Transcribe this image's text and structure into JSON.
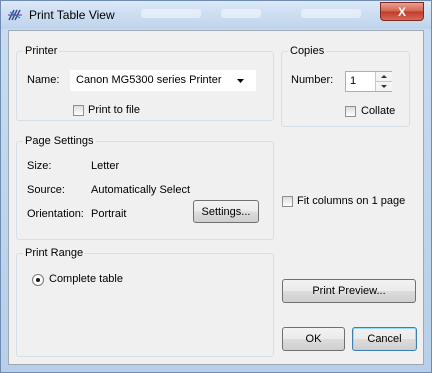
{
  "window": {
    "title": "Print Table View",
    "close_label": "X"
  },
  "printer": {
    "group_label": "Printer",
    "name_label": "Name:",
    "name_value": "Canon MG5300 series Printer",
    "print_to_file_label": "Print to file",
    "print_to_file_checked": false
  },
  "copies": {
    "group_label": "Copies",
    "number_label": "Number:",
    "number_value": "1",
    "collate_label": "Collate",
    "collate_checked": false
  },
  "page_settings": {
    "group_label": "Page Settings",
    "size_label": "Size:",
    "size_value": "Letter",
    "source_label": "Source:",
    "source_value": "Automatically Select",
    "orientation_label": "Orientation:",
    "orientation_value": "Portrait",
    "settings_button": "Settings..."
  },
  "fit_columns_label": "Fit columns on 1 page",
  "print_range": {
    "group_label": "Print Range",
    "complete_table_label": "Complete table"
  },
  "buttons": {
    "print_preview": "Print Preview...",
    "ok": "OK",
    "cancel": "Cancel"
  }
}
